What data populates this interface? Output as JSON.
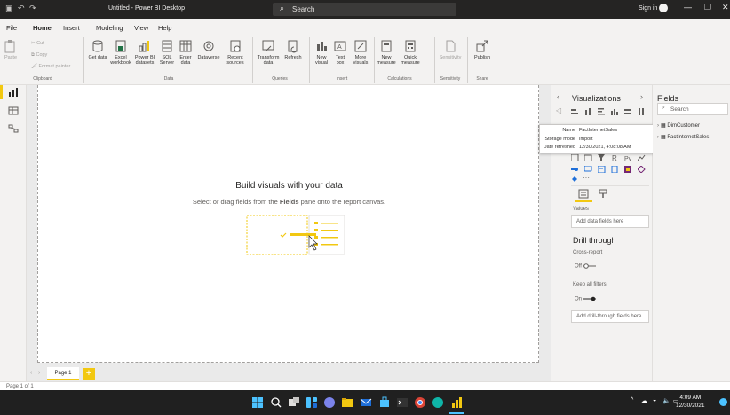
{
  "window": {
    "title": "Untitled - Power BI Desktop",
    "search_placeholder": "Search",
    "sign_in": "Sign in"
  },
  "menu": {
    "tabs": [
      "File",
      "Home",
      "Insert",
      "Modeling",
      "View",
      "Help"
    ],
    "active": "Home"
  },
  "ribbon": {
    "clipboard": {
      "cut": "Cut",
      "copy": "Copy",
      "paste": "Paste",
      "format_painter": "Format painter",
      "label": "Clipboard"
    },
    "data": {
      "get_data": "Get data",
      "excel": "Excel workbook",
      "powerbi": "Power BI datasets",
      "sql": "SQL Server",
      "enter": "Enter data",
      "dataverse": "Dataverse",
      "recent": "Recent sources",
      "label": "Data"
    },
    "queries": {
      "transform": "Transform data",
      "refresh": "Refresh",
      "label": "Queries"
    },
    "insert": {
      "new_visual": "New visual",
      "text_box": "Text box",
      "more_visuals": "More visuals",
      "label": "Insert"
    },
    "calculations": {
      "new_measure": "New measure",
      "quick_measure": "Quick measure",
      "label": "Calculations"
    },
    "sensitivity": {
      "sensitivity": "Sensitivity",
      "label": "Sensitivity"
    },
    "share": {
      "publish": "Publish",
      "label": "Share"
    }
  },
  "canvas": {
    "heading": "Build visuals with your data",
    "sub_before": "Select or drag fields from the ",
    "sub_bold": "Fields",
    "sub_after": " pane onto the report canvas."
  },
  "pages": {
    "tab": "Page 1",
    "add": "+"
  },
  "status": {
    "page_info": "Page 1 of 1"
  },
  "visualizations": {
    "title": "Visualizations",
    "values_label": "Values",
    "add_data_fields": "Add data fields here",
    "drill_through_title": "Drill through",
    "cross_report_label": "Cross-report",
    "cross_report_state": "Off",
    "keep_filters_label": "Keep all filters",
    "keep_filters_state": "On",
    "add_drill_fields": "Add drill-through fields here"
  },
  "tooltip": {
    "name_label": "Name",
    "name_value": "FactInternetSales",
    "storage_label": "Storage mode",
    "storage_value": "Import",
    "refreshed_label": "Date refreshed",
    "refreshed_value": "12/30/2021, 4:08:08 AM"
  },
  "fields": {
    "title": "Fields",
    "search_placeholder": "Search",
    "tables": [
      "DimCustomer",
      "FactInternetSales"
    ]
  },
  "taskbar": {
    "time": "4:09 AM",
    "date": "12/30/2021"
  },
  "colors": {
    "accent": "#f2c811",
    "titlebar": "#252423",
    "taskbar": "#202020",
    "pane_bg": "#f3f2f1"
  }
}
